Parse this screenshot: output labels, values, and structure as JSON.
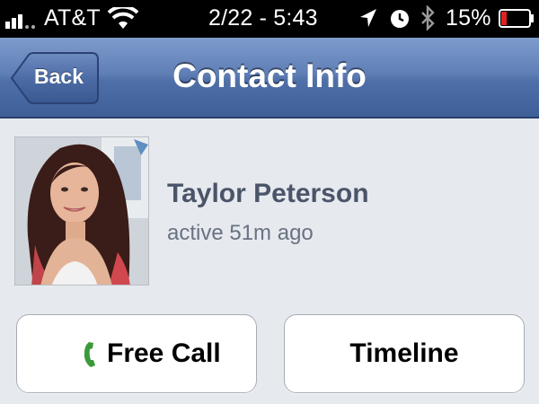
{
  "status_bar": {
    "carrier": "AT&T",
    "time": "2/22 - 5:43",
    "battery_percent": "15%",
    "battery_level": 0.15,
    "signal_bars": 3,
    "icons": [
      "signal-icon",
      "wifi-icon",
      "location-arrow-icon",
      "alarm-clock-icon",
      "bluetooth-icon",
      "battery-icon"
    ]
  },
  "nav": {
    "back_label": "Back",
    "title": "Contact Info"
  },
  "contact": {
    "name": "Taylor Peterson",
    "activity": "active 51m ago"
  },
  "actions": {
    "call_label": "Free Call",
    "timeline_label": "Timeline"
  },
  "colors": {
    "nav_bar": "#5f7fb6",
    "background": "#e6e9ee",
    "phone_icon": "#3a9a3a",
    "battery_low": "#e22020"
  }
}
